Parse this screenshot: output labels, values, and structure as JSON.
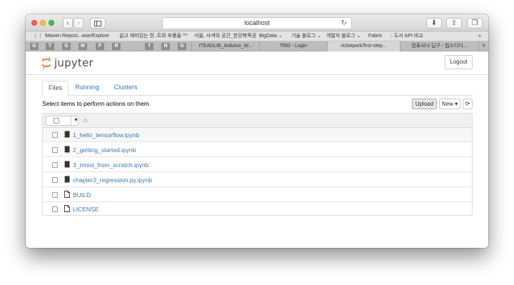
{
  "browser": {
    "address": "localhost",
    "bookmarks": [
      "Maven Reposi...wse/Explore",
      "쉽고 재미있는 전..트와 부품들 ^^",
      "서울, 사색의 공간_한강북쪽권",
      "BigData ⌄",
      "기술 블로그 ⌄",
      "개발자 블로그 ⌄",
      "Fabric",
      ":: 도서 API 비교"
    ],
    "favtabs": [
      "G",
      "T",
      "G",
      "M",
      "F",
      "R",
      "f",
      "N",
      "G"
    ],
    "page_tabs": [
      "ITEADLIB_Arduino_W...",
      "Til60 - Login",
      "rickiepark/first-step...",
      "컴퓨사나 딥구 - 칩스디디..."
    ]
  },
  "header": {
    "logo_text": "jupyter",
    "logout_label": "Logout"
  },
  "tabs": [
    {
      "label": "Files"
    },
    {
      "label": "Running"
    },
    {
      "label": "Clusters"
    }
  ],
  "toolbar": {
    "select_text": "Select items to perform actions on them.",
    "upload_label": "Upload",
    "new_label": "New ▾",
    "refresh_icon": "refresh-icon"
  },
  "files": [
    {
      "name": "1_hello_tensorflow.ipynb",
      "type": "notebook"
    },
    {
      "name": "2_getting_started.ipynb",
      "type": "notebook"
    },
    {
      "name": "3_mnist_from_scratch.ipynb",
      "type": "notebook"
    },
    {
      "name": "chapter2_regression.py.ipynb",
      "type": "notebook"
    },
    {
      "name": "BUILD",
      "type": "file"
    },
    {
      "name": "LICENSE",
      "type": "file"
    }
  ],
  "colors": {
    "link": "#337ab7",
    "jupyter_orange": "#f37726"
  }
}
